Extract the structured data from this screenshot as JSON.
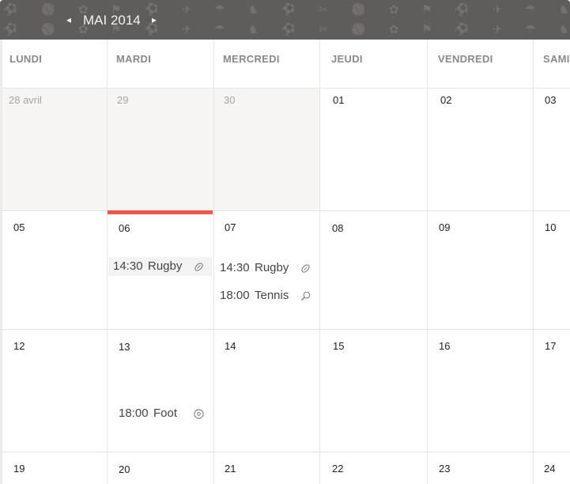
{
  "header": {
    "month_label": "MAI 2014",
    "prev_symbol": "◂",
    "next_symbol": "▸",
    "pattern_glyphs": "⚽ ⚾ ✿ ⚑ ⚽ ✈ ☂ ♞ ⚽ ✂ ⚾ ✿ ⚑ ⚽ ✈ ☂ ♞ ⚽ ✂ ⚾ ✿ ⚑ ⚽ ✈"
  },
  "day_names": [
    "LUNDI",
    "MARDI",
    "MERCREDI",
    "JEUDI",
    "VENDREDI",
    "SAMI"
  ],
  "weeks": [
    [
      "28 avril",
      "29",
      "30",
      "01",
      "02",
      "03"
    ],
    [
      "05",
      "06",
      "07",
      "08",
      "09",
      "10"
    ],
    [
      "12",
      "13",
      "14",
      "15",
      "16",
      "17"
    ],
    [
      "19",
      "20",
      "21",
      "22",
      "23",
      "24"
    ]
  ],
  "events": [
    {
      "time": "14:30",
      "sport": "Rugby",
      "icon": "rugby-ball-icon"
    },
    {
      "time": "14:30",
      "sport": "Rugby",
      "icon": "rugby-ball-icon"
    },
    {
      "time": "18:00",
      "sport": "Tennis",
      "icon": "tennis-racket-icon"
    },
    {
      "time": "18:00",
      "sport": "Foot",
      "icon": "soccer-ball-icon"
    }
  ],
  "colors": {
    "header_bg": "#5f5d5c",
    "today_marker": "#f0574b",
    "other_month_bg": "#f6f5f3"
  }
}
